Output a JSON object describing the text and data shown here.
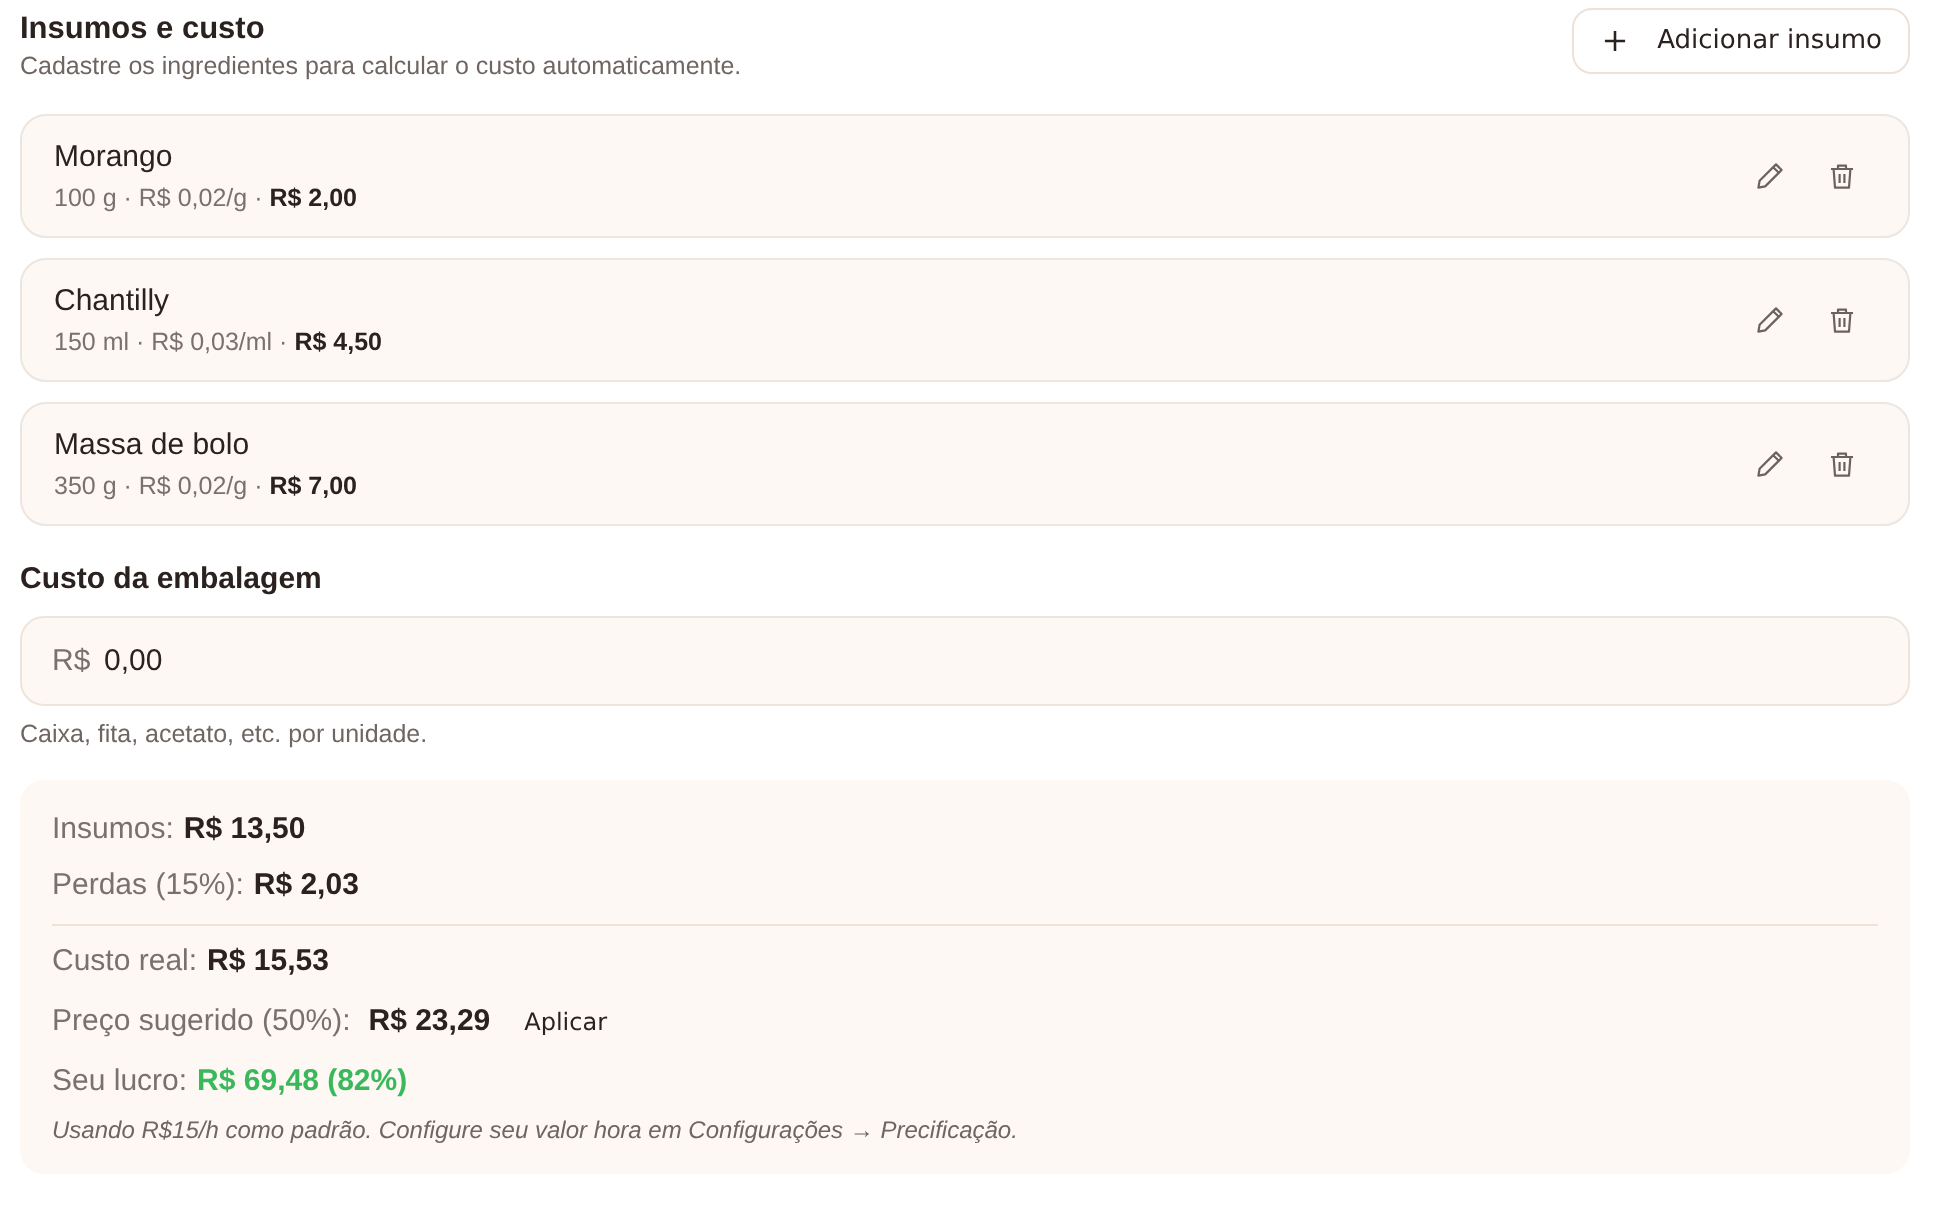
{
  "header": {
    "title": "Insumos e custo",
    "subtitle": "Cadastre os ingredientes para calcular o custo automaticamente.",
    "add_button": {
      "label": "Adicionar insumo"
    }
  },
  "ingredients": [
    {
      "name": "Morango",
      "details": "100 g · R$ 0,02/g · **R$ 2,00**"
    },
    {
      "name": "Chantilly",
      "details": "150 ml · R$ 0,03/ml · **R$ 4,50**"
    },
    {
      "name": "Massa de bolo",
      "details": "350 g · R$ 0,02/g · **R$ 7,00**"
    }
  ],
  "packaging": {
    "label": "Custo da embalagem",
    "prefix": "R$",
    "value": "0,00",
    "hint": "Caixa, fita, acetato, etc. por unidade."
  },
  "summary": {
    "subtotals": [
      {
        "kind": "amount",
        "label": "Insumos:",
        "value": "R$ 13,50"
      },
      {
        "kind": "amount",
        "label": "Perdas (15%):",
        "value": "R$ 2,03"
      }
    ],
    "totals": [
      {
        "kind": "amount",
        "label": "Custo real:",
        "value": "R$ 15,53"
      },
      {
        "kind": "suggested",
        "label": "Preço sugerido (50%):",
        "value": "R$ 23,29",
        "action": "Aplicar"
      },
      {
        "kind": "profit",
        "label": "Seu lucro:",
        "value": "R$ 69,48 (82%)"
      }
    ],
    "note": "Usando R$15/h como padrão. Configure seu valor hora em Configurações → Precificação."
  }
}
